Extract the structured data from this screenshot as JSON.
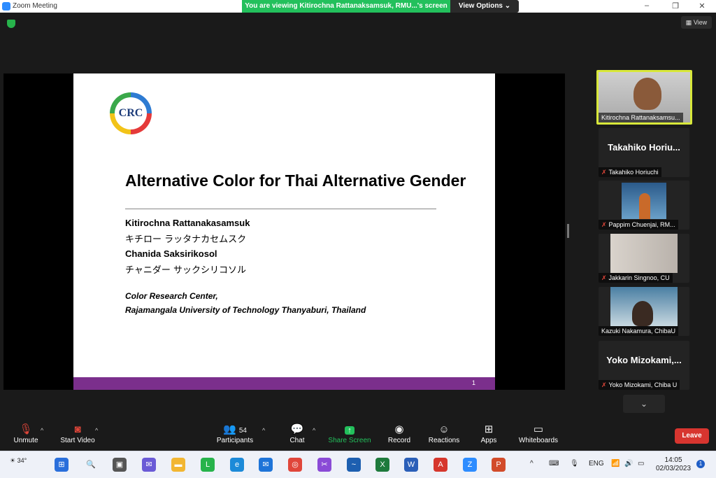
{
  "window": {
    "title": "Zoom Meeting",
    "share_banner": "You are viewing Kitirochna Rattanaksamsuk, RMU...'s screen",
    "view_options": "View Options",
    "view_button": "View"
  },
  "slide": {
    "logo_text": "CRC",
    "title": "Alternative Color for Thai Alternative Gender",
    "author1": "Kitirochna Rattanakasamsuk",
    "author1_jp": "キチロー ラッタナカセムスク",
    "author2": "Chanida Saksirikosol",
    "author2_jp": "チャニダー サックシリコソル",
    "affiliation1": "Color Research Center,",
    "affiliation2": "Rajamangala University of Technology Thanyaburi, Thailand",
    "page_number": "1",
    "footer_color": "#7b2f8c"
  },
  "participants_panel": [
    {
      "name": "Kitirochna Rattanaksamsu...",
      "type": "video",
      "active": true
    },
    {
      "display": "Takahiko  Horiu...",
      "name": "Takahiko Horiuchi",
      "type": "name",
      "muted": true
    },
    {
      "name": "Pappim Chuenjai, RM...",
      "type": "video",
      "muted": true
    },
    {
      "name": "Jakkarin Singnoo, CU",
      "type": "video",
      "muted": true
    },
    {
      "name": "Kazuki Nakamura, ChibaU",
      "type": "video",
      "muted": false
    },
    {
      "display": "Yoko  Mizokami,...",
      "name": "Yoko Mizokami, Chiba U",
      "type": "name",
      "muted": true
    }
  ],
  "toolbar": {
    "unmute": "Unmute",
    "start_video": "Start Video",
    "participants": "Participants",
    "participants_count": "54",
    "chat": "Chat",
    "share_screen": "Share Screen",
    "record": "Record",
    "reactions": "Reactions",
    "apps": "Apps",
    "whiteboards": "Whiteboards",
    "leave": "Leave"
  },
  "taskbar": {
    "weather": "34°",
    "language": "ENG",
    "time": "14:05",
    "date": "02/03/2023",
    "notifications": "1"
  }
}
